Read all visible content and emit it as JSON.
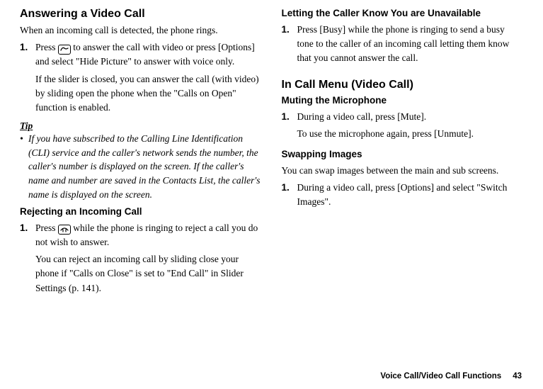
{
  "left": {
    "h1": "Answering a Video Call",
    "intro": "When an incoming call is detected, the phone rings.",
    "step1_num": "1.",
    "step1_a": "Press",
    "step1_b": "to answer the call with video or press [Options] and select \"Hide Picture\" to answer with voice only.",
    "step1_p2": "If the slider is closed, you can answer the call (with video) by sliding open the phone when the \"Calls on Open\" function is enabled.",
    "tip_label": "Tip",
    "tip_text": "If you have subscribed to the Calling Line Identification (CLI) service and the caller's network sends the number, the caller's number is displayed on the screen. If the caller's name and number are saved in the Contacts List, the caller's name is displayed on the screen.",
    "h2_reject": "Rejecting an Incoming Call",
    "reject_num": "1.",
    "reject_a": "Press",
    "reject_b": "while the phone is ringing to reject a call you do not wish to answer.",
    "reject_p2": "You can reject an incoming call by sliding close your phone if \"Calls on Close\" is set to \"End Call\" in Slider Settings (p. 141)."
  },
  "right": {
    "h2_busy": "Letting the Caller Know You are Unavailable",
    "busy_num": "1.",
    "busy_text": "Press [Busy] while the phone is ringing to send a busy tone to the caller of an incoming call letting them know that you cannot answer the call.",
    "h1_menu": "In Call Menu (Video Call)",
    "h2_mute": "Muting the Microphone",
    "mute_num": "1.",
    "mute_text": "During a video call, press [Mute].",
    "mute_p2": "To use the microphone again, press [Unmute].",
    "h2_swap": "Swapping Images",
    "swap_intro": "You can swap images between the main and sub screens.",
    "swap_num": "1.",
    "swap_text": "During a video call, press [Options] and select \"Switch Images\"."
  },
  "footer": {
    "label": "Voice Call/Video Call Functions",
    "page": "43"
  }
}
